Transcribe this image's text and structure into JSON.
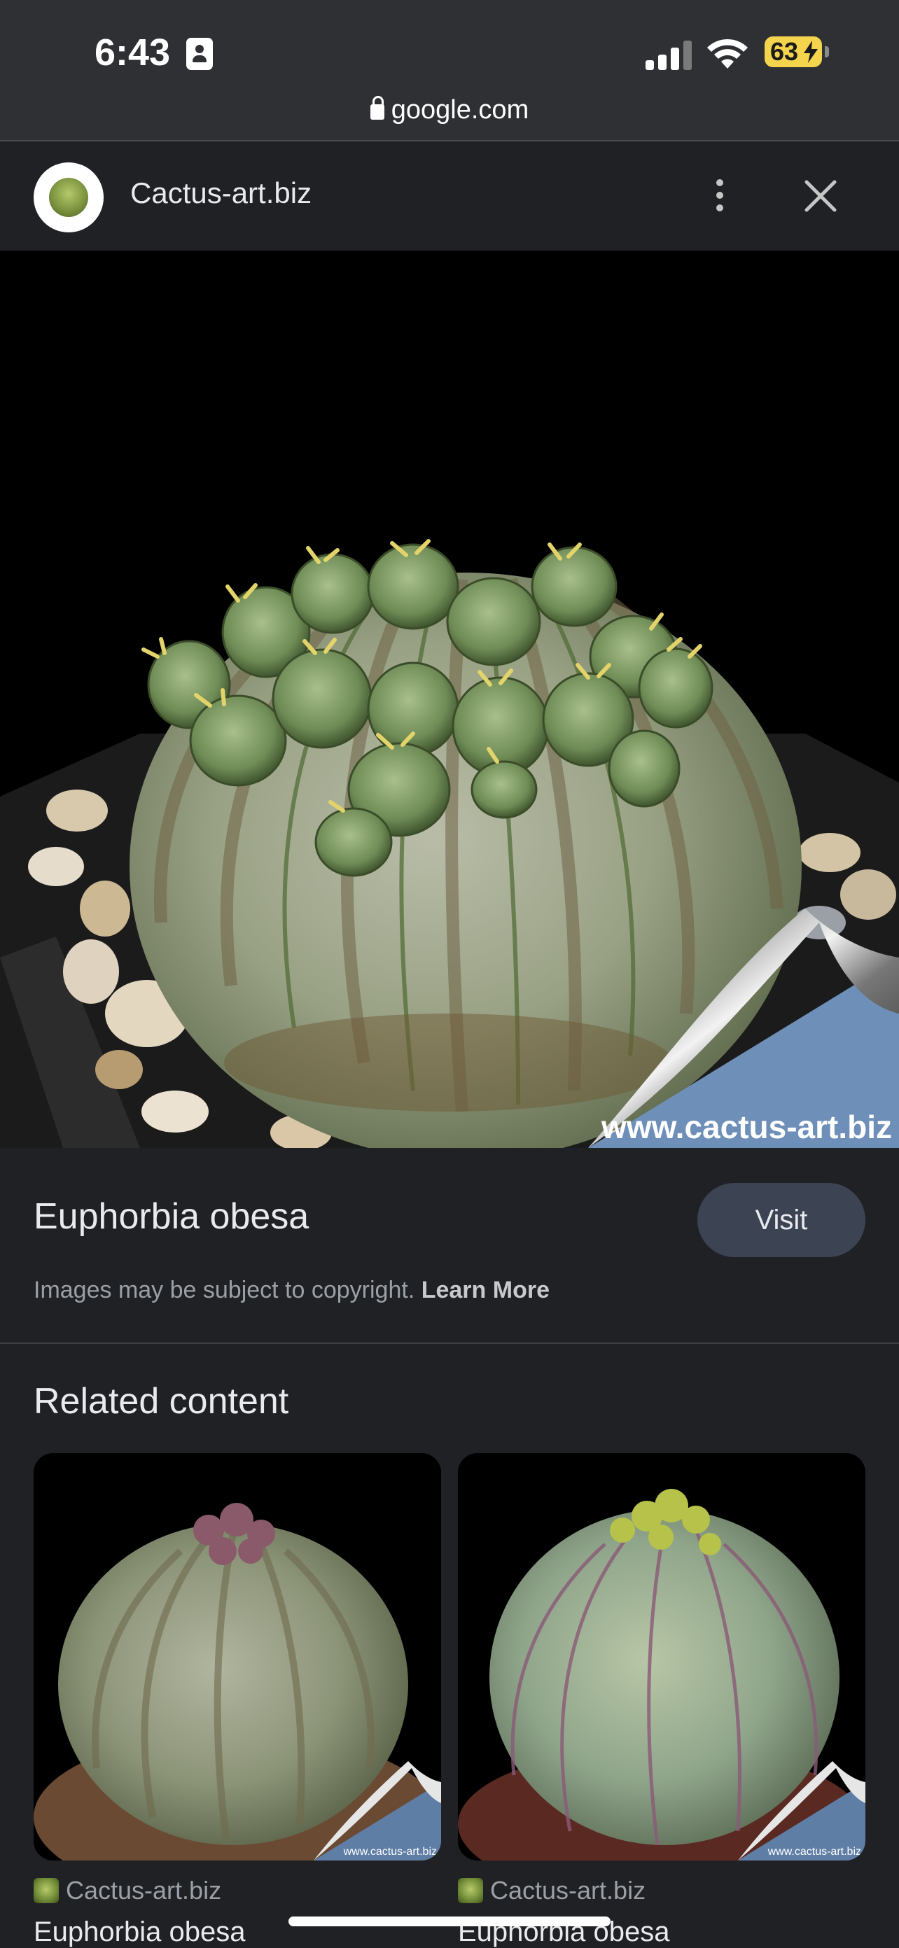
{
  "status_bar": {
    "time": "6:43",
    "battery": "63",
    "battery_color": "#f4d44d"
  },
  "browser": {
    "domain": "google.com"
  },
  "header": {
    "site_name": "Cactus-art.biz",
    "icons": [
      "more-vert-icon",
      "close-icon"
    ]
  },
  "main": {
    "image_watermark": "www.cactus-art.biz",
    "title": "Euphorbia obesa",
    "visit_label": "Visit",
    "copyright_text": "Images may be subject to copyright.",
    "learn_more_label": "Learn More"
  },
  "related": {
    "heading": "Related content",
    "cards": [
      {
        "source": "Cactus-art.biz",
        "title": "Euphorbia obesa",
        "watermark": "www.cactus-art.biz"
      },
      {
        "source": "Cactus-art.biz",
        "title": "Euphorbia obesa",
        "watermark": "www.cactus-art.biz"
      }
    ]
  },
  "colors": {
    "background": "#202124",
    "visit_button": "#3c4353"
  }
}
